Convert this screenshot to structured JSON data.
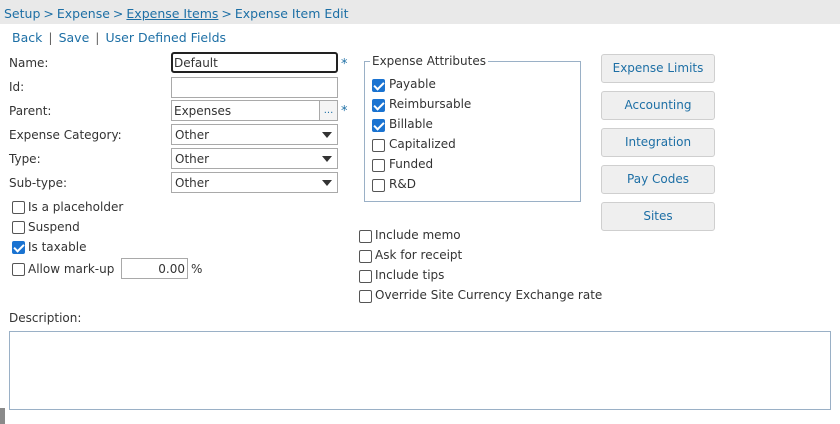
{
  "breadcrumb": {
    "items": [
      "Setup",
      "Expense",
      "Expense Items",
      "Expense Item Edit"
    ],
    "separator": ">"
  },
  "toolbar": {
    "back": "Back",
    "save": "Save",
    "user_defined_fields": "User Defined Fields",
    "separator": "|"
  },
  "form": {
    "name_label": "Name:",
    "name_value": "Default",
    "id_label": "Id:",
    "id_value": "",
    "parent_label": "Parent:",
    "parent_value": "Expenses",
    "lookup_label": "...",
    "required_mark": "*",
    "expense_category_label": "Expense Category:",
    "expense_category_value": "Other",
    "type_label": "Type:",
    "type_value": "Other",
    "subtype_label": "Sub-type:",
    "subtype_value": "Other",
    "is_placeholder": {
      "label": "Is a placeholder",
      "checked": false
    },
    "suspend": {
      "label": "Suspend",
      "checked": false
    },
    "is_taxable": {
      "label": "Is taxable",
      "checked": true
    },
    "allow_markup": {
      "label": "Allow mark-up",
      "checked": false,
      "value": "0.00",
      "unit": "%"
    },
    "description_label": "Description:"
  },
  "attributes": {
    "legend": "Expense Attributes",
    "items": [
      {
        "label": "Payable",
        "checked": true
      },
      {
        "label": "Reimbursable",
        "checked": true
      },
      {
        "label": "Billable",
        "checked": true
      },
      {
        "label": "Capitalized",
        "checked": false
      },
      {
        "label": "Funded",
        "checked": false
      },
      {
        "label": "R&D",
        "checked": false
      }
    ]
  },
  "options": {
    "items": [
      {
        "label": "Include memo",
        "checked": false
      },
      {
        "label": "Ask for receipt",
        "checked": false
      },
      {
        "label": "Include tips",
        "checked": false
      },
      {
        "label": "Override Site Currency Exchange rate",
        "checked": false
      }
    ]
  },
  "side_buttons": [
    "Expense Limits",
    "Accounting",
    "Integration",
    "Pay Codes",
    "Sites"
  ],
  "colors": {
    "link": "#1d6fa5",
    "check": "#1a73d1",
    "breadcrumb_bg": "#e9e9e9"
  }
}
